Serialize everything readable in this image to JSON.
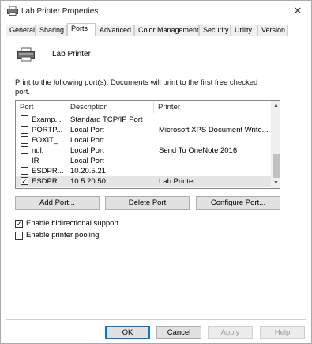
{
  "window": {
    "title": "Lab Printer Properties"
  },
  "tabs": [
    {
      "label": "General"
    },
    {
      "label": "Sharing"
    },
    {
      "label": "Ports"
    },
    {
      "label": "Advanced"
    },
    {
      "label": "Color Management"
    },
    {
      "label": "Security"
    },
    {
      "label": "Utility"
    },
    {
      "label": "Version"
    }
  ],
  "active_tab": "Ports",
  "printer_name": "Lab Printer",
  "instructions": "Print to the following port(s). Documents will print to the first free checked port.",
  "ports": {
    "columns": {
      "port": "Port",
      "description": "Description",
      "printer": "Printer"
    },
    "rows": [
      {
        "port": "Examp...",
        "description": "Standard TCP/IP Port",
        "printer": "",
        "checked": false
      },
      {
        "port": "PORTP...",
        "description": "Local Port",
        "printer": "Microsoft XPS Document Write...",
        "checked": false
      },
      {
        "port": "FOXIT_...",
        "description": "Local Port",
        "printer": "",
        "checked": false
      },
      {
        "port": "nul:",
        "description": "Local Port",
        "printer": "Send To OneNote 2016",
        "checked": false
      },
      {
        "port": "IR",
        "description": "Local Port",
        "printer": "",
        "checked": false
      },
      {
        "port": "ESDPR...",
        "description": "10.20.5.21",
        "printer": "",
        "checked": false
      },
      {
        "port": "ESDPR...",
        "description": "10.5.20.50",
        "printer": "Lab Printer",
        "checked": true,
        "selected": true
      }
    ],
    "scroll_up_icon": "▲",
    "scroll_down_icon": "▼"
  },
  "port_buttons": {
    "add": "Add Port...",
    "delete": "Delete Port",
    "configure": "Configure Port..."
  },
  "options": {
    "bidirectional": {
      "label": "Enable bidirectional support",
      "checked": true
    },
    "pooling": {
      "label": "Enable printer pooling",
      "checked": false
    }
  },
  "dialog_buttons": {
    "ok": "OK",
    "cancel": "Cancel",
    "apply": "Apply",
    "help": "Help"
  },
  "colors": {
    "selection": "#e5e5e5",
    "accent": "#0078d7"
  }
}
